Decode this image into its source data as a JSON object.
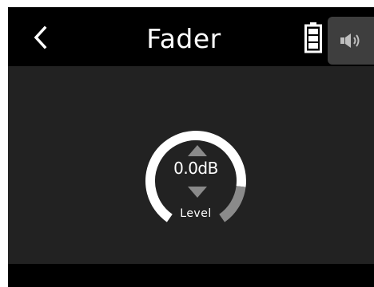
{
  "header": {
    "title": "Fader"
  },
  "icons": {
    "back": "chevron-left-icon",
    "battery": "battery-icon",
    "speaker": "speaker-icon"
  },
  "fader": {
    "value": "0.0dB",
    "label": "Level",
    "db": 0.0
  },
  "colors": {
    "background": "#000000",
    "content": "#222222",
    "dial_track": "#ffffff",
    "dial_inactive": "#8a8a8a",
    "accent_button": "#3e3e3e"
  }
}
